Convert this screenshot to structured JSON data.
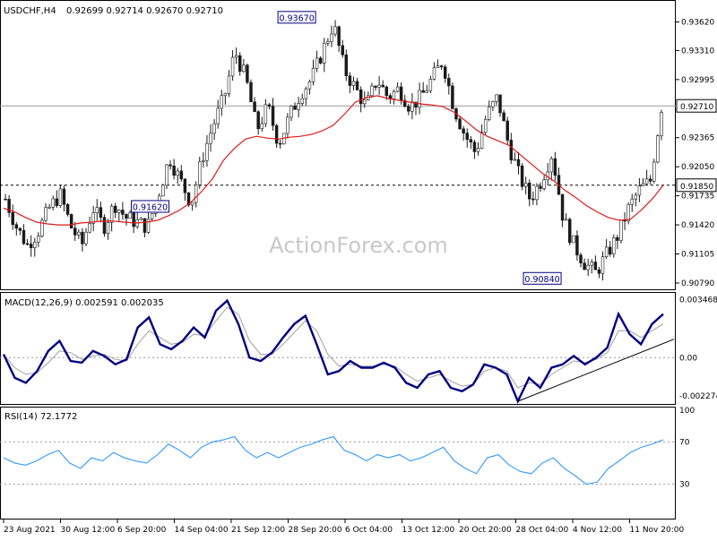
{
  "header": {
    "symbol": "USDCHF,H4",
    "ohlc": "0.92699 0.92714 0.92670 0.92710"
  },
  "watermark": "ActionForex.com",
  "chart_data": [
    {
      "type": "candlestick",
      "title": "USDCHF,H4",
      "price_ticks": [
        "0.93620",
        "0.93310",
        "0.92995",
        "0.92365",
        "0.92050",
        "0.91735",
        "0.91420",
        "0.91105",
        "0.90790"
      ],
      "ylim": [
        0.9077,
        0.9378
      ],
      "current_price": "0.92710",
      "level_line": "0.91850",
      "annotations": [
        {
          "text": "0.93670",
          "x_index": 80,
          "value": 0.9367
        },
        {
          "text": "0.91620",
          "x_index": 40,
          "value": 0.9162
        },
        {
          "text": "0.90840",
          "x_index": 147,
          "value": 0.9084
        }
      ],
      "moving_average": [
        0.916,
        0.9156,
        0.915,
        0.9145,
        0.9143,
        0.9142,
        0.9142,
        0.9144,
        0.9145,
        0.9146,
        0.9146,
        0.9145,
        0.9144,
        0.9145,
        0.9147,
        0.9152,
        0.9158,
        0.9166,
        0.9178,
        0.9192,
        0.9212,
        0.9225,
        0.9235,
        0.9238,
        0.9236,
        0.9235,
        0.9237,
        0.9238,
        0.924,
        0.9244,
        0.925,
        0.9262,
        0.9275,
        0.928,
        0.9282,
        0.9279,
        0.9277,
        0.9275,
        0.9273,
        0.9272,
        0.927,
        0.9264,
        0.9255,
        0.9245,
        0.9238,
        0.9233,
        0.9228,
        0.9218,
        0.9208,
        0.9198,
        0.919,
        0.918,
        0.9172,
        0.9163,
        0.9156,
        0.915,
        0.9147,
        0.9148,
        0.9158,
        0.917,
        0.9185
      ],
      "price_path": [
        0.917,
        0.914,
        0.912,
        0.9135,
        0.916,
        0.9175,
        0.914,
        0.912,
        0.916,
        0.914,
        0.9165,
        0.915,
        0.9145,
        0.914,
        0.9175,
        0.9215,
        0.919,
        0.9165,
        0.9215,
        0.925,
        0.928,
        0.933,
        0.93,
        0.9245,
        0.927,
        0.923,
        0.926,
        0.9285,
        0.93,
        0.933,
        0.936,
        0.931,
        0.929,
        0.927,
        0.93,
        0.928,
        0.929,
        0.927,
        0.928,
        0.93,
        0.932,
        0.927,
        0.924,
        0.922,
        0.926,
        0.928,
        0.923,
        0.9195,
        0.917,
        0.919,
        0.922,
        0.915,
        0.912,
        0.91,
        0.909,
        0.911,
        0.913,
        0.916,
        0.918,
        0.919,
        0.927
      ]
    },
    {
      "type": "line",
      "title": "MACD(12,26,9) 0.002591 0.002035",
      "series": [
        {
          "name": "MACD",
          "values": [
            0.0002,
            -0.0012,
            -0.0015,
            -0.0008,
            0.0004,
            0.001,
            -0.0002,
            -0.0003,
            0.0004,
            0.0001,
            -0.0004,
            -0.0001,
            0.0018,
            0.0024,
            0.0008,
            0.0005,
            0.001,
            0.0018,
            0.0012,
            0.0028,
            0.0034,
            0.002,
            0.0,
            -0.0002,
            0.0003,
            0.0012,
            0.002,
            0.0025,
            0.0008,
            -0.001,
            -0.0008,
            -0.0002,
            -0.0006,
            -0.0006,
            -0.0003,
            -0.0006,
            -0.0015,
            -0.0018,
            -0.001,
            -0.0008,
            -0.0018,
            -0.002,
            -0.0016,
            -0.0004,
            -0.0006,
            -0.001,
            -0.0026,
            -0.0012,
            -0.0018,
            -0.0006,
            -0.0004,
            0.0001,
            -0.0004,
            0.0,
            0.0006,
            0.0026,
            0.0014,
            0.0008,
            0.002,
            0.0026
          ]
        },
        {
          "name": "Signal",
          "values": [
            0.0002,
            -0.0006,
            -0.001,
            -0.0009,
            -0.0003,
            0.0004,
            0.0003,
            -0.0001,
            0.0001,
            0.0002,
            -0.0001,
            -0.0002,
            0.0008,
            0.0016,
            0.0012,
            0.0008,
            0.0009,
            0.0014,
            0.0013,
            0.0022,
            0.003,
            0.0026,
            0.001,
            0.0002,
            0.0002,
            0.0008,
            0.0015,
            0.0022,
            0.0016,
            0.0002,
            -0.0005,
            -0.0004,
            -0.0005,
            -0.0005,
            -0.0004,
            -0.0005,
            -0.001,
            -0.0014,
            -0.0012,
            -0.001,
            -0.0014,
            -0.0017,
            -0.0016,
            -0.0008,
            -0.0006,
            -0.0008,
            -0.0018,
            -0.0015,
            -0.0016,
            -0.001,
            -0.0006,
            -0.0002,
            -0.0003,
            -0.0001,
            0.0003,
            0.0016,
            0.0016,
            0.0012,
            0.0016,
            0.002
          ]
        }
      ],
      "ticks": [
        "0.003468",
        "0.00",
        "-0.002274"
      ],
      "ylim": [
        -0.0026,
        0.0037
      ],
      "trendline": "from the late-October low to the right edge"
    },
    {
      "type": "line",
      "title": "RSI(14) 72.1772",
      "series": [
        {
          "name": "RSI",
          "values": [
            55,
            50,
            48,
            52,
            58,
            62,
            50,
            45,
            55,
            52,
            60,
            55,
            52,
            50,
            58,
            68,
            62,
            55,
            65,
            70,
            72,
            75,
            62,
            55,
            60,
            55,
            60,
            65,
            68,
            72,
            75,
            62,
            58,
            52,
            58,
            55,
            58,
            52,
            55,
            60,
            65,
            52,
            45,
            40,
            55,
            58,
            48,
            42,
            40,
            50,
            55,
            45,
            38,
            30,
            32,
            45,
            52,
            60,
            65,
            68,
            72
          ]
        }
      ],
      "ticks": [
        "100",
        "70",
        "30",
        "0"
      ],
      "ylim": [
        0,
        100
      ],
      "levels": [
        70,
        30
      ]
    }
  ],
  "x_axis_labels": [
    "23 Aug 2021",
    "30 Aug 12:00",
    "6 Sep 20:00",
    "14 Sep 04:00",
    "21 Sep 12:00",
    "28 Sep 20:00",
    "6 Oct 04:00",
    "13 Oct 12:00",
    "20 Oct 20:00",
    "28 Oct 04:00",
    "4 Nov 12:00",
    "11 Nov 20:00"
  ],
  "colors": {
    "candles": "#1a1a1a",
    "moving_average": "#e01818",
    "macd": "#000080",
    "signal": "#a0a0a0",
    "rsi": "#1e90ff",
    "grid": "#b0b0b0"
  }
}
